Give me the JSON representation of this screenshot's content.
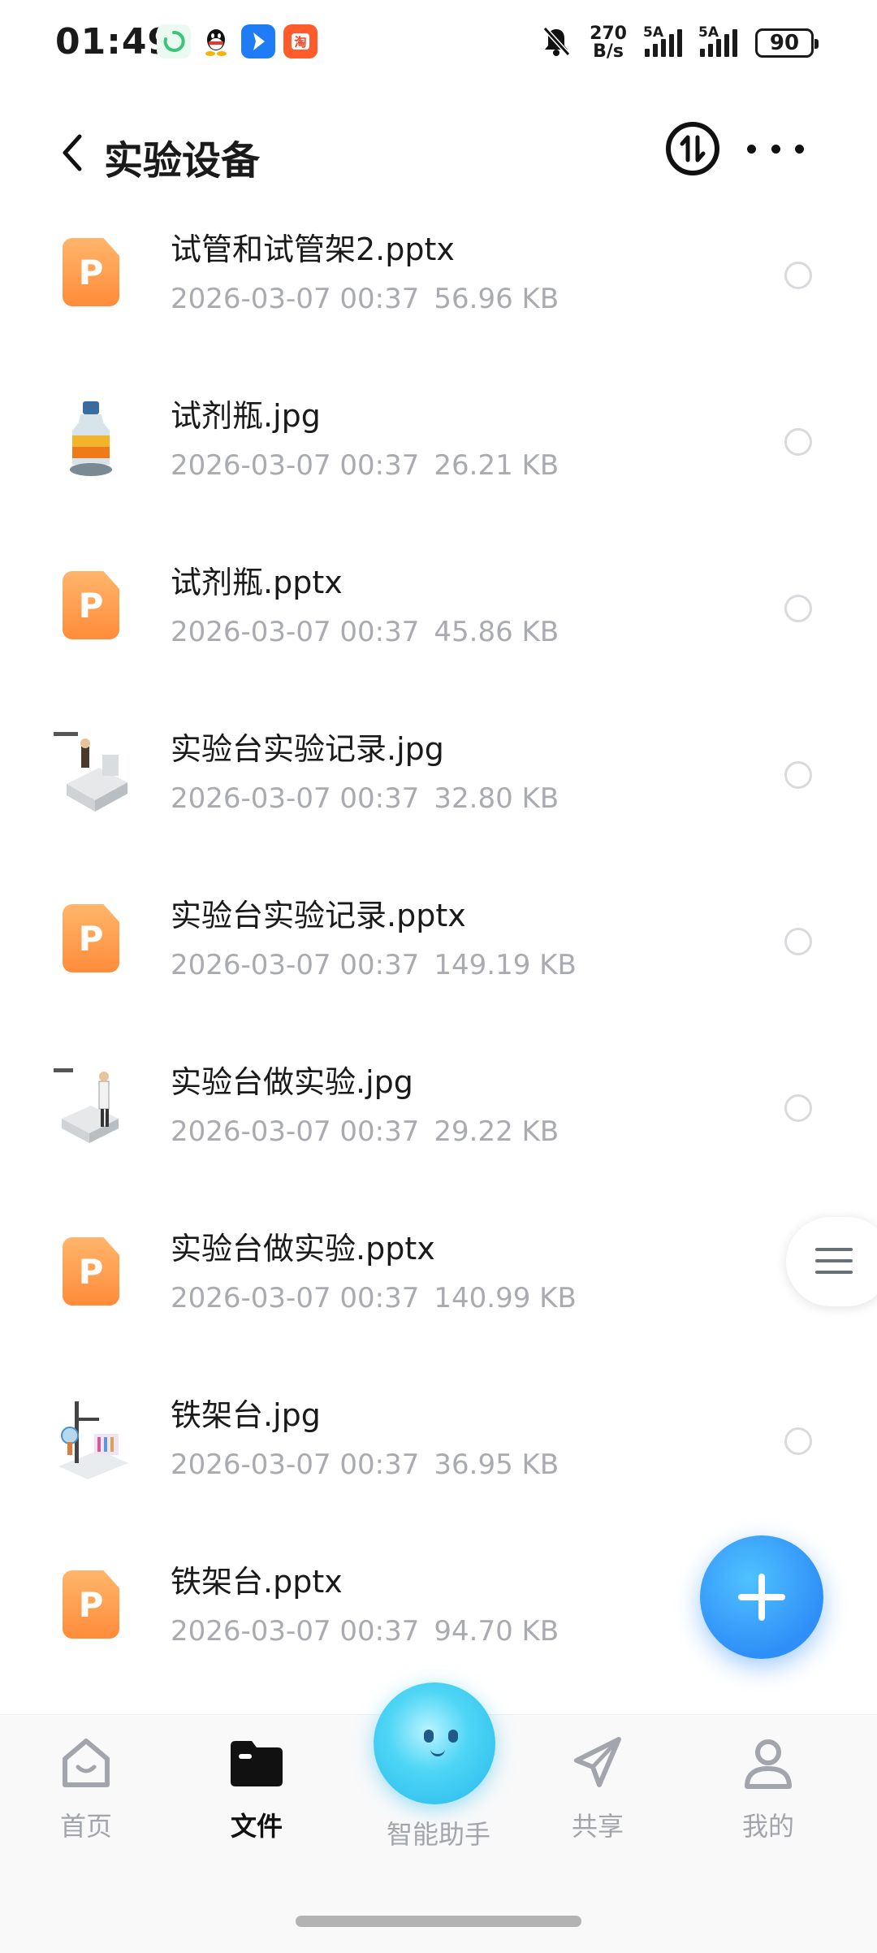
{
  "status_bar": {
    "time": "01:49",
    "net_speed_value": "270",
    "net_speed_unit": "B/s",
    "signal_1_tag": "5A",
    "signal_2_tag": "5A",
    "battery": "90"
  },
  "header": {
    "title": "实验设备"
  },
  "files": [
    {
      "name": "试管和试管架2.pptx",
      "date": "2026-03-07 00:37",
      "size": "56.96 KB",
      "type": "pptx"
    },
    {
      "name": "试剂瓶.jpg",
      "date": "2026-03-07 00:37",
      "size": "26.21 KB",
      "type": "jpg"
    },
    {
      "name": "试剂瓶.pptx",
      "date": "2026-03-07 00:37",
      "size": "45.86 KB",
      "type": "pptx"
    },
    {
      "name": "实验台实验记录.jpg",
      "date": "2026-03-07 00:37",
      "size": "32.80 KB",
      "type": "jpg"
    },
    {
      "name": "实验台实验记录.pptx",
      "date": "2026-03-07 00:37",
      "size": "149.19 KB",
      "type": "pptx"
    },
    {
      "name": "实验台做实验.jpg",
      "date": "2026-03-07 00:37",
      "size": "29.22 KB",
      "type": "jpg"
    },
    {
      "name": "实验台做实验.pptx",
      "date": "2026-03-07 00:37",
      "size": "140.99 KB",
      "type": "pptx"
    },
    {
      "name": "铁架台.jpg",
      "date": "2026-03-07 00:37",
      "size": "36.95 KB",
      "type": "jpg"
    },
    {
      "name": "铁架台.pptx",
      "date": "2026-03-07 00:37",
      "size": "94.70 KB",
      "type": "pptx"
    }
  ],
  "ppt_icon_letter": "P",
  "bottom_nav": {
    "home": "首页",
    "files": "文件",
    "assistant": "智能助手",
    "share": "共享",
    "me": "我的"
  },
  "colors": {
    "ppt_orange": "#ff8c3a",
    "fab_blue": "#2f8ff8",
    "meta_gray": "#a9abb0"
  }
}
